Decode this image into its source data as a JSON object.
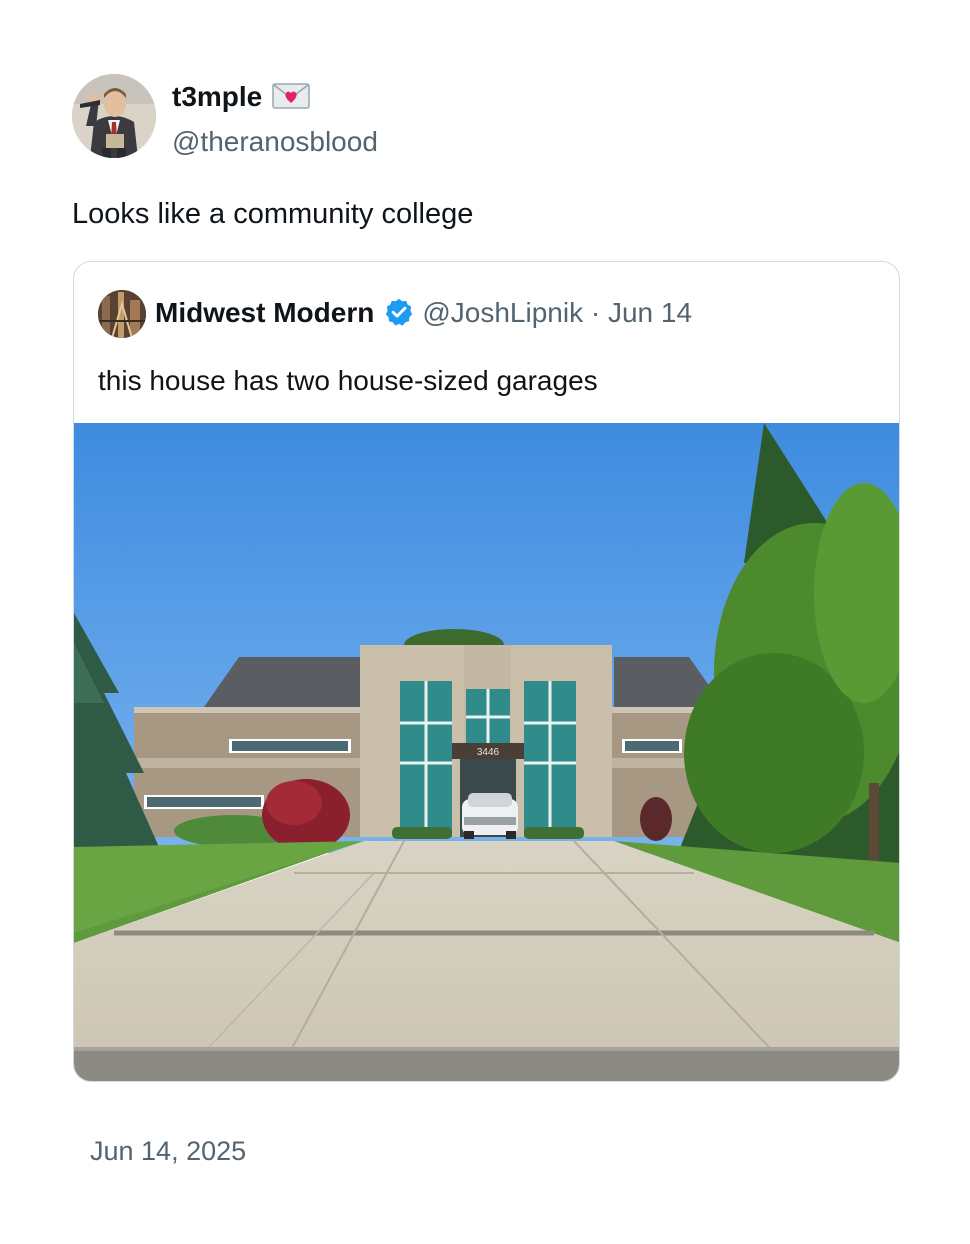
{
  "author": {
    "name": "t3mple",
    "handle": "@theranosblood",
    "name_emoji": "love-letter-icon"
  },
  "tweet": {
    "text": "Looks like a community college",
    "date": "Jun 14, 2025"
  },
  "quoted": {
    "name": "Midwest Modern",
    "verified": true,
    "handle": "@JoshLipnik",
    "separator": "·",
    "date": "Jun 14",
    "text": "this house has two house-sized garages",
    "photo": {
      "house_number": "3446"
    }
  },
  "colors": {
    "text_primary": "#0f1419",
    "text_secondary": "#536471",
    "border": "#cfd9de",
    "verified_blue": "#1d9bf0",
    "sky": "#4f9ae4"
  }
}
